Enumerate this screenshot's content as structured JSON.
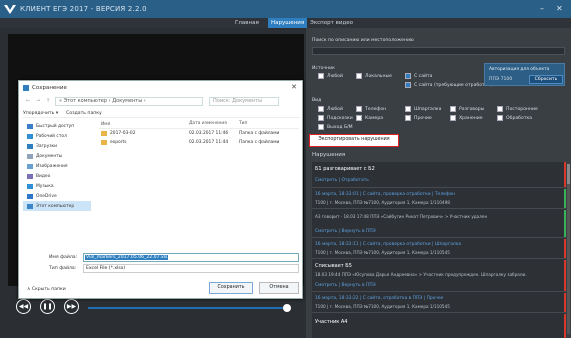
{
  "app": {
    "title": "КЛИЕНТ ЕГЭ 2017 - ВЕРСИЯ 2.2.0",
    "minimize": "–",
    "close": "✕"
  },
  "tabs": [
    {
      "label": "Главная"
    },
    {
      "label": "Нарушения",
      "active": true
    },
    {
      "label": "Экспорт видео"
    }
  ],
  "player": {
    "rewind": "◀◀",
    "pause": "❚❚",
    "forward": "▶▶",
    "progress": 0.98
  },
  "dialog": {
    "title": "Сохранение",
    "path": "« Этот компьютер › Документы ›",
    "search_placeholder": "Поиск: Документы",
    "toolbar": [
      "Упорядочить ▾",
      "Создать папку"
    ],
    "nav": [
      "Быстрый доступ",
      "Рабочий стол",
      "Загрузки",
      "Документы",
      "Изображения",
      "Видео",
      "Музыка",
      "OneDrive",
      "Этот компьютер"
    ],
    "columns": [
      "Имя",
      "Дата изменения",
      "Тип"
    ],
    "files": [
      {
        "name": "2017-03-02",
        "date": "02.03.2017 11:46",
        "type": "Папка с файлами"
      },
      {
        "name": "exports",
        "date": "02.03.2017 11:44",
        "type": "Папка с файлами"
      }
    ],
    "file_name_label": "Имя файла:",
    "file_name": "Viol_markers_2017.05.06_22.07.xls",
    "file_type_label": "Тип файла:",
    "file_type": "Excel File (*.xlsx)",
    "hide_folders": "∧ Скрыть папки",
    "save": "Сохранить",
    "cancel": "Отмена"
  },
  "filters": {
    "search_label": "Поиск по описанию или местоположению",
    "source_label": "Источник",
    "sources": [
      "Любой",
      "Локальные",
      "С сайта",
      "С сайта (требующие отработки)"
    ],
    "auth_title": "Авторизация для объекта",
    "auth_code": "ППЭ 7100",
    "reset": "Сбросить",
    "type_label": "Вид",
    "types": [
      "Любой",
      "Телефон",
      "Шпаргалка",
      "Разговоры",
      "Посторонние",
      "Подсказки",
      "Камера",
      "Прочие",
      "Хранение",
      "Обработка",
      "Выход Б/М"
    ],
    "export_btn": "Экспортировать нарушения",
    "violations_title": "Нарушения"
  },
  "violations": [
    {
      "title": "Б1 разговаривает с Б2",
      "links": "Смотреть | Отработать",
      "bar": "#d9372b"
    },
    {
      "title": "",
      "blue": "16 марта, 18:33:01 | С сайта, проверка отработки | Телефон",
      "grey": "7100 | г. Москва, ППЭ №7100, Аудитория 1, Камера 1/110498",
      "bar": "#3bb15a"
    },
    {
      "title": "",
      "grey": "А3 говорит · 18.03 17:48 ППЭ «Сайбугин Ринат Петрович» > Участник удален",
      "links": "Смотреть | Вернуть в ППЭ",
      "bar": "#3bb15a"
    },
    {
      "title": "",
      "blue": "16 марта, 18:33:11 | С сайта, проверка отработки | Шпаргалка",
      "grey": "7100 | г. Москва, ППЭ №7100, Аудитория 1, Камера 1/110545",
      "bar": "#d9372b"
    },
    {
      "title": "Списывает Б5",
      "grey": "18.03 19:44 ППЭ «Юсупова Дарья Андреевна» > Участник предупрежден. Шпаргалку забрали.",
      "links": "Смотреть | Вернуть в ППЭ",
      "bar": "#d9372b"
    },
    {
      "title": "",
      "blue": "16 марта, 18:33:22 | С сайта, отработка в ППЭ | Прочее",
      "grey": "7100 | г. Москва, ППЭ №7100, Аудитория 1, Камера 1/110545",
      "bar": "#d9372b"
    },
    {
      "title": "Участник А4",
      "bar": "#d9372b"
    }
  ]
}
